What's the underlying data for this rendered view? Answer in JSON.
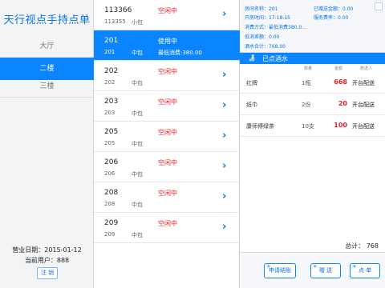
{
  "app": {
    "title": "天行视点手持点单"
  },
  "floors": [
    {
      "label": "大厅",
      "active": false
    },
    {
      "label": "二楼",
      "active": true
    },
    {
      "label": "三楼",
      "active": false
    }
  ],
  "footer": {
    "business_date": "营业日期：2015-01-12",
    "current_user": "当前用户：888",
    "logout_label": "注 销"
  },
  "rooms": [
    {
      "number": "113366",
      "status": "空闲中",
      "sub": "113355",
      "type": "小包",
      "min": ""
    },
    {
      "number": "201",
      "status": "使用中",
      "sub": "201",
      "type": "中包",
      "min": "最低消费:380.00"
    },
    {
      "number": "202",
      "status": "空闲中",
      "sub": "202",
      "type": "中包",
      "min": ""
    },
    {
      "number": "203",
      "status": "空闲中",
      "sub": "203",
      "type": "中包",
      "min": ""
    },
    {
      "number": "205",
      "status": "空闲中",
      "sub": "205",
      "type": "中包",
      "min": ""
    },
    {
      "number": "206",
      "status": "空闲中",
      "sub": "206",
      "type": "中包",
      "min": ""
    },
    {
      "number": "208",
      "status": "空闲中",
      "sub": "208",
      "type": "中包",
      "min": ""
    },
    {
      "number": "209",
      "status": "空闲中",
      "sub": "209",
      "type": "中包",
      "min": ""
    }
  ],
  "detail": {
    "room_name": "房间名称：201",
    "open_time": "开房时间：17:18:15",
    "gift_amount": "已赠送金额：0.00",
    "service_rate": "服务费率：0.00",
    "consume_method": "消费方式：最低消费380.0...",
    "min_diff": "低消差额：0.00",
    "drinks_total": "酒水合计：768.00"
  },
  "served": {
    "label": "已点酒水",
    "icon": "drink-icon",
    "columns": {
      "qty": "数量",
      "amount": "金额",
      "giver": "赠送人"
    },
    "items": [
      {
        "name": "红牌",
        "qty": "1瓶",
        "amount": "668",
        "action": "开台配送"
      },
      {
        "name": "纸巾",
        "qty": "2份",
        "amount": "20",
        "action": "开台配送"
      },
      {
        "name": "康师傅绿茶",
        "qty": "10支",
        "amount": "100",
        "action": "开台配送"
      }
    ]
  },
  "total": "总计：  768",
  "toolbar": {
    "settle_label": "申请结账",
    "gift_label": "赠 送",
    "order_label": "点 单"
  },
  "colors": {
    "accent": "#0a84ff",
    "status_red": "#e8202a"
  }
}
